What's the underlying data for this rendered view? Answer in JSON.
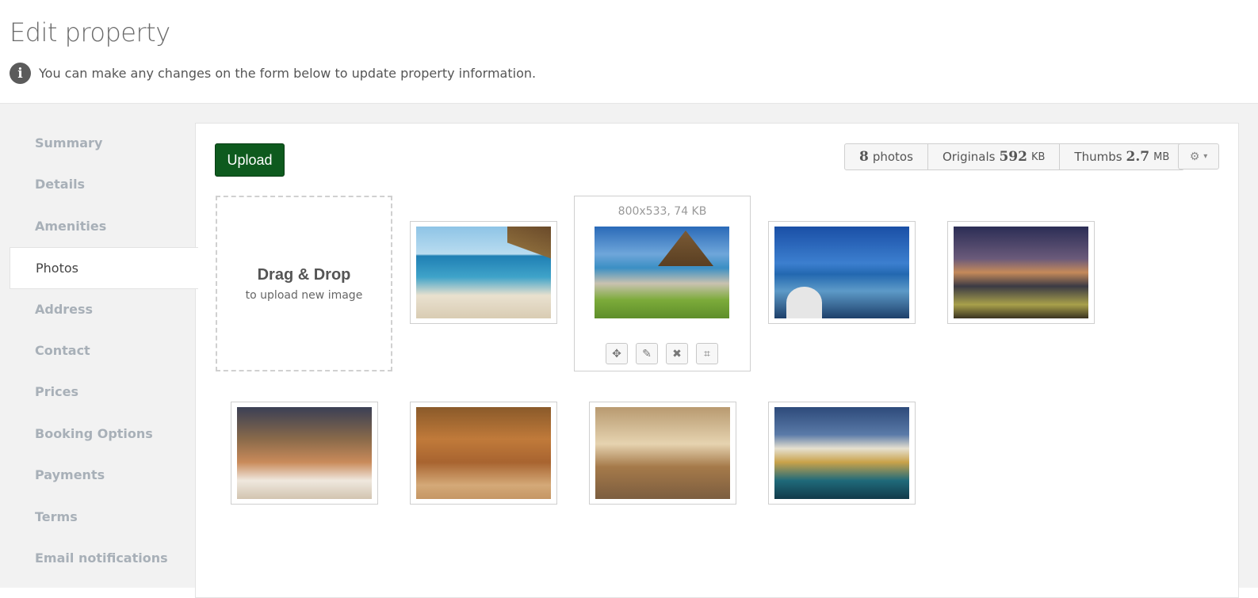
{
  "header": {
    "title": "Edit property",
    "info_text": "You can make any changes on the form below to update property information."
  },
  "sidebar": {
    "items": [
      {
        "label": "Summary",
        "active": false
      },
      {
        "label": "Details",
        "active": false
      },
      {
        "label": "Amenities",
        "active": false
      },
      {
        "label": "Photos",
        "active": true
      },
      {
        "label": "Address",
        "active": false
      },
      {
        "label": "Contact",
        "active": false
      },
      {
        "label": "Prices",
        "active": false
      },
      {
        "label": "Booking Options",
        "active": false
      },
      {
        "label": "Payments",
        "active": false
      },
      {
        "label": "Terms",
        "active": false
      },
      {
        "label": "Email notifications",
        "active": false
      }
    ]
  },
  "toolbar": {
    "upload_label": "Upload",
    "photos_count": "8",
    "photos_label": "photos",
    "originals_label": "Originals",
    "originals_size": "592",
    "originals_unit": "KB",
    "thumbs_label": "Thumbs",
    "thumbs_size": "2.7",
    "thumbs_unit": "MB",
    "settings_icon": "gear-icon"
  },
  "dropzone": {
    "title": "Drag & Drop",
    "subtitle": "to upload new image"
  },
  "hovered_photo": {
    "meta": "800x533, 74 KB",
    "tools": [
      "move-icon",
      "edit-icon",
      "delete-icon",
      "crop-icon"
    ]
  },
  "colors": {
    "upload_button": "#0e5a1e",
    "sidebar_text": "#a8b0b8",
    "body_background": "#f2f2f2"
  }
}
